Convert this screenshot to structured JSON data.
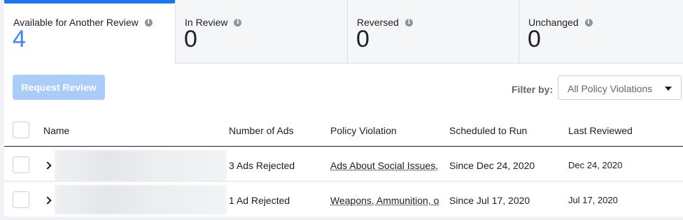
{
  "tabs": [
    {
      "label": "Available for Another Review",
      "count": "4"
    },
    {
      "label": "In Review",
      "count": "0"
    },
    {
      "label": "Reversed",
      "count": "0"
    },
    {
      "label": "Unchanged",
      "count": "0"
    }
  ],
  "toolbar": {
    "request_review_label": "Request Review",
    "filter_label": "Filter by:",
    "filter_value": "All Policy Violations"
  },
  "table": {
    "columns": [
      "Name",
      "Number of Ads",
      "Policy Violation",
      "Scheduled to Run",
      "Last Reviewed"
    ],
    "rows": [
      {
        "ads": "3 Ads Rejected",
        "policy": "Ads About Social Issues,",
        "scheduled": "Since Dec 24, 2020",
        "reviewed": "Dec 24, 2020"
      },
      {
        "ads": "1 Ad Rejected",
        "policy": "Weapons, Ammunition, o",
        "scheduled": "Since Jul 17, 2020",
        "reviewed": "Jul 17, 2020"
      }
    ]
  },
  "colors": {
    "accent": "#1877f2",
    "count_active": "#4080ff",
    "button_disabled": "#a9cdf8"
  }
}
